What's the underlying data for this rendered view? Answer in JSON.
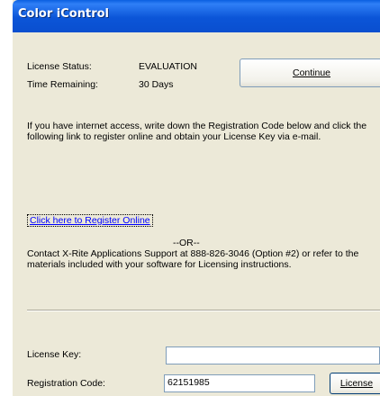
{
  "window": {
    "title": "Color iControl"
  },
  "status": {
    "license_status_label": "License Status:",
    "license_status_value": "EVALUATION",
    "time_remaining_label": "Time Remaining:",
    "time_remaining_value": "30 Days",
    "continue_label": "Continue"
  },
  "info": {
    "instructions": "If you have internet access, write down the Registration Code below and click the following link to register online and obtain your License Key via e-mail.",
    "register_link": "Click here to Register Online",
    "or_separator": "--OR--",
    "contact_text": "Contact X-Rite Applications Support at 888-826-3046 (Option #2) or refer to the materials included with your software for Licensing instructions."
  },
  "license": {
    "license_key_label": "License Key:",
    "license_key_value": "",
    "registration_code_label": "Registration Code:",
    "registration_code_value": "62151985",
    "license_button_label": "License"
  }
}
